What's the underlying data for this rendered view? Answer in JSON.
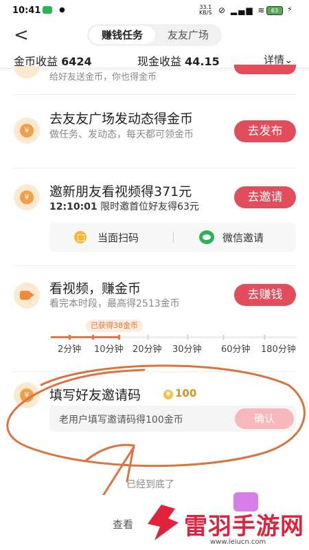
{
  "status": {
    "time": "10:41",
    "net_speed": "33.1",
    "net_unit": "KB/S",
    "battery": "63"
  },
  "header": {
    "back_label": "<",
    "tabs": [
      "赚钱任务",
      "友友广场"
    ]
  },
  "earnings": {
    "gold_label": "金币收益",
    "gold_value": "6424",
    "cash_label": "现金收益",
    "cash_value": "44.15",
    "detail_label": "详情⌄"
  },
  "cut_task": {
    "desc": "给好友送金币，你也得金币"
  },
  "tasks": [
    {
      "title": "去友友广场发动态得金币",
      "desc": "做任务、发动态，每天都可领金币",
      "button": "去发布"
    },
    {
      "title": "邀新朋友看视频得371元",
      "timer": "12:10:01",
      "desc": "限时邀首位好友得63元",
      "button": "去邀请",
      "options": [
        "当面扫码",
        "微信邀请"
      ]
    },
    {
      "title": "看视频，赚金币",
      "desc": "看完本时段，最高得2513金币",
      "button": "去赚钱",
      "progress_badge": "已获得38金币",
      "progress_fraction": 0.28,
      "milestones": [
        "2分钟",
        "10分钟",
        "20分钟",
        "30分钟",
        "60分钟",
        "180分钟"
      ]
    },
    {
      "title": "填写好友邀请码",
      "reward": "100",
      "placeholder": "老用户填写邀请码得100金币",
      "button": "确认"
    }
  ],
  "footer": {
    "end_text": "已经到底了",
    "more_text": "查看"
  },
  "watermark": {
    "text": "雷羽手游网",
    "url": "www.leiucn.com"
  },
  "colors": {
    "accent": "#e34c5a",
    "progress": "#e9743d",
    "coin": "#f0a04b",
    "wechat": "#2bb35a"
  },
  "icons": [
    "coin-icon",
    "video-camera-icon",
    "qr-code-icon",
    "wechat-icon",
    "gift-icon"
  ]
}
